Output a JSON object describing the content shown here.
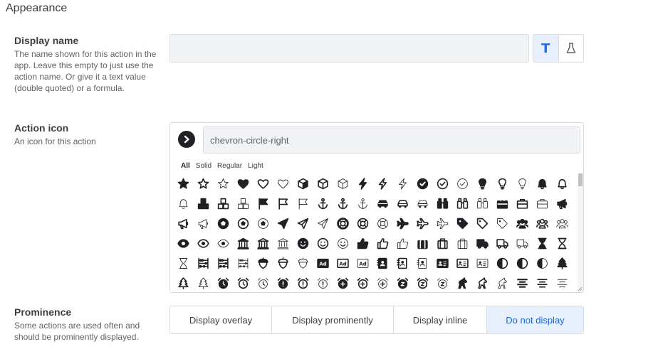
{
  "section": {
    "title": "Appearance"
  },
  "display_name": {
    "label": "Display name",
    "description": "The name shown for this action in the app. Leave this empty to just use the action name. Or give it a text value (double quoted) or a formula.",
    "value": "",
    "type_options": [
      {
        "icon": "text-type-icon",
        "glyph": "T",
        "active": true
      },
      {
        "icon": "formula-flask-icon",
        "active": false
      }
    ],
    "accent_color": "#1a73e8"
  },
  "action_icon": {
    "label": "Action icon",
    "description": "An icon for this action",
    "selected_icon": "chevron-circle-right-icon",
    "search_value": "chevron-circle-right",
    "filters": [
      {
        "label": "All",
        "active": true
      },
      {
        "label": "Solid",
        "active": false
      },
      {
        "label": "Regular",
        "active": false
      },
      {
        "label": "Light",
        "active": false
      }
    ],
    "icons": [
      [
        "star-solid",
        "star-regular",
        "star-light",
        "heart-solid",
        "heart-regular",
        "heart-light",
        "cube-solid",
        "cube-regular",
        "cube-light",
        "bolt-solid",
        "bolt-regular",
        "bolt-light",
        "check-circle-solid",
        "check-circle-regular",
        "check-circle-light",
        "lightbulb-solid",
        "lightbulb-regular",
        "lightbulb-light",
        "bell-solid",
        "bell-regular"
      ],
      [
        "bell-light",
        "cubes-solid",
        "cubes-regular",
        "cubes-light",
        "flag-solid",
        "flag-regular",
        "flag-light",
        "anchor-solid",
        "anchor-regular",
        "anchor-light",
        "car-solid",
        "car-regular",
        "car-light",
        "binoculars-solid",
        "binoculars-regular",
        "binoculars-light",
        "briefcase-solid",
        "briefcase-regular",
        "briefcase-light",
        "bullhorn-solid"
      ],
      [
        "bullhorn-regular",
        "bullhorn-light",
        "futbol-solid",
        "futbol-regular",
        "futbol-light",
        "paper-plane-solid",
        "paper-plane-regular",
        "paper-plane-light",
        "life-ring-solid",
        "life-ring-regular",
        "life-ring-light",
        "plane-solid",
        "plane-regular",
        "plane-light",
        "tag-solid",
        "tag-regular",
        "tag-light",
        "users-solid",
        "users-regular",
        "users-light"
      ],
      [
        "eye-solid",
        "eye-regular",
        "eye-light",
        "university-solid",
        "university-regular",
        "university-light",
        "smile-solid",
        "smile-regular",
        "smile-light",
        "thumbs-up-solid",
        "thumbs-up-regular",
        "thumbs-up-light",
        "suitcase-solid",
        "suitcase-regular",
        "suitcase-light",
        "truck-solid",
        "truck-regular",
        "truck-light",
        "hourglass-solid",
        "hourglass-regular"
      ],
      [
        "hourglass-light",
        "abacus-solid",
        "abacus-regular",
        "abacus-light",
        "acorn-solid",
        "acorn-regular",
        "acorn-light",
        "ad-solid",
        "ad-regular",
        "ad-light",
        "address-book-solid",
        "address-book-regular",
        "address-book-light",
        "address-card-solid",
        "address-card-regular",
        "address-card-light",
        "adjust-solid",
        "adjust-regular",
        "adjust-light",
        "tree-solid"
      ],
      [
        "tree-regular",
        "tree-light",
        "alarm-clock-solid",
        "alarm-clock-regular",
        "alarm-clock-light",
        "alarm-exclamation-solid",
        "alarm-exclamation-regular",
        "alarm-exclamation-light",
        "alarm-plus-solid",
        "alarm-plus-regular",
        "alarm-plus-light",
        "alarm-snooze-solid",
        "alarm-snooze-regular",
        "alarm-snooze-light",
        "alicorn-solid",
        "alicorn-regular",
        "alicorn-light",
        "align-center-solid",
        "align-center-regular",
        "align-center-light"
      ]
    ]
  },
  "prominence": {
    "label": "Prominence",
    "description": "Some actions are used often and should be prominently displayed.",
    "options": [
      {
        "label": "Display overlay",
        "active": false
      },
      {
        "label": "Display prominently",
        "active": false
      },
      {
        "label": "Display inline",
        "active": false
      },
      {
        "label": "Do not display",
        "active": true
      }
    ],
    "active_color": "#1967d2"
  }
}
